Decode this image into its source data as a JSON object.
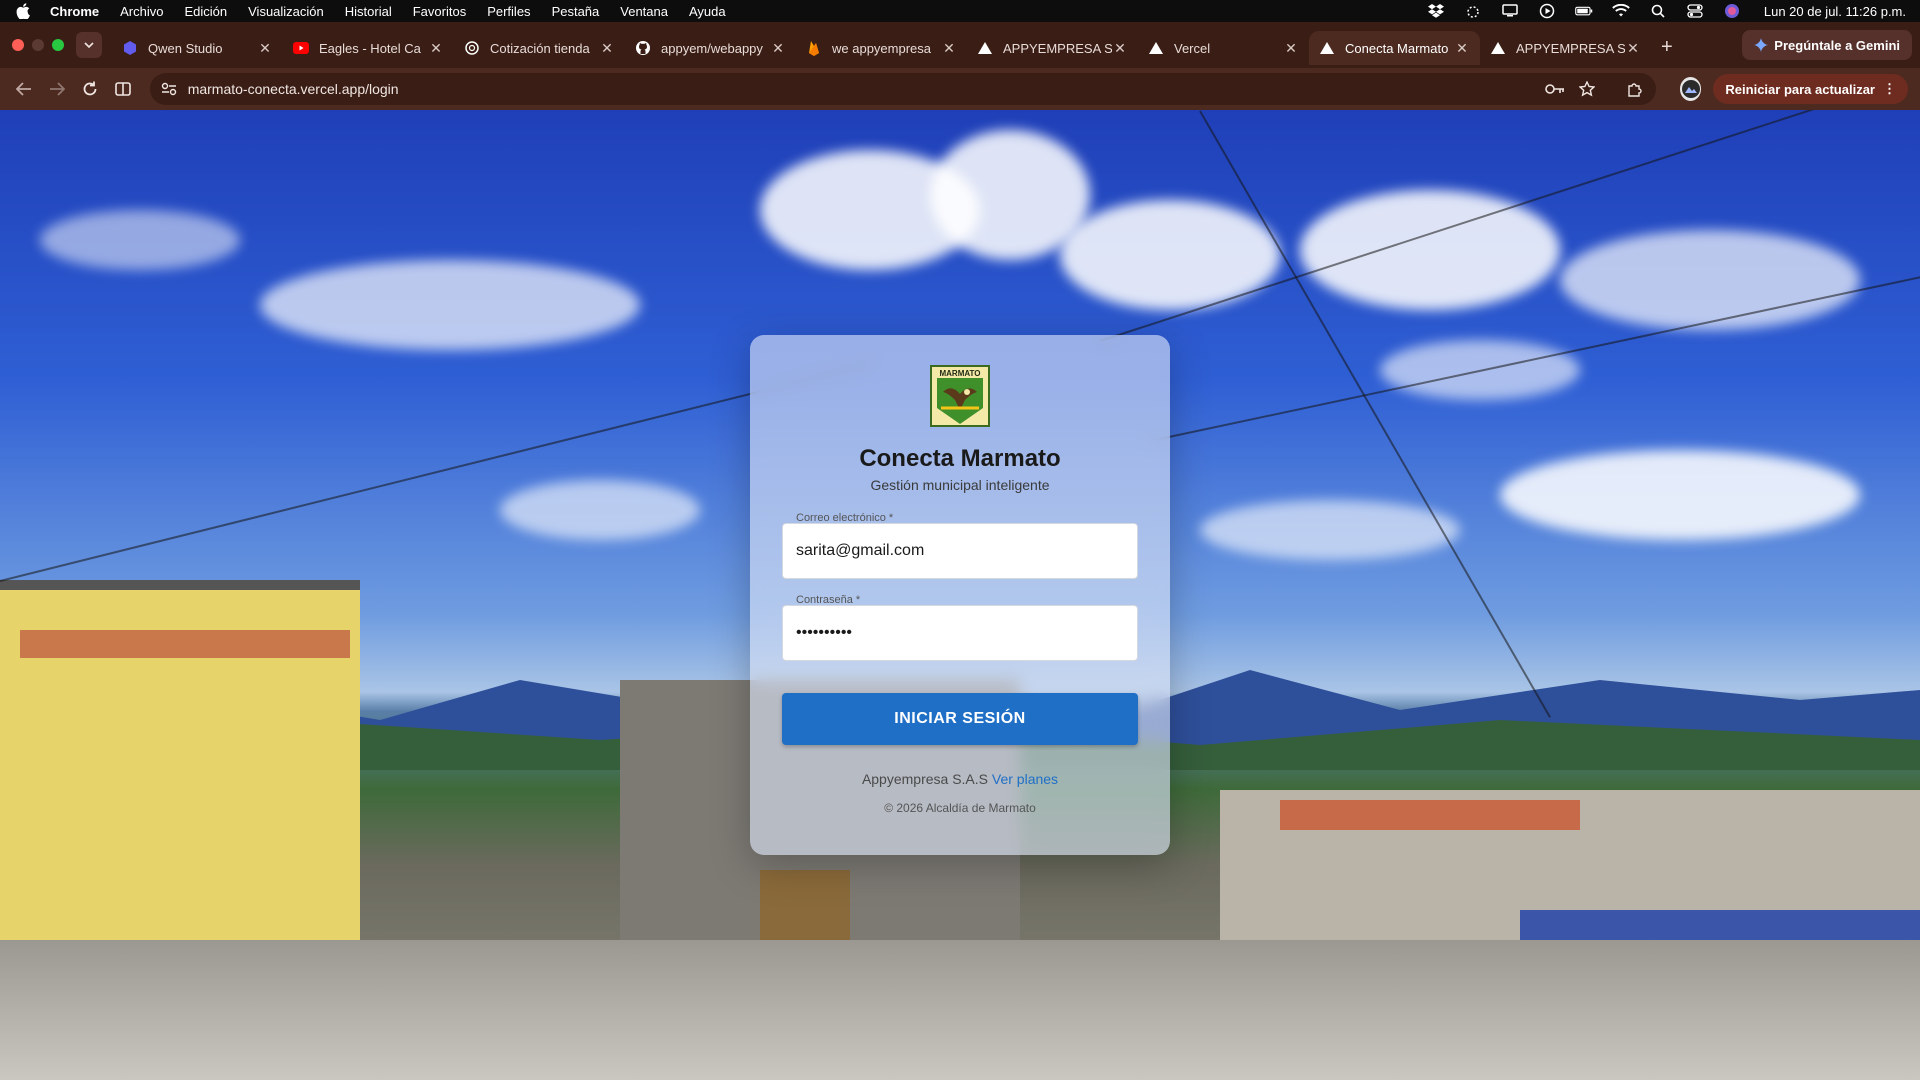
{
  "menubar": {
    "app": "Chrome",
    "items": [
      "Archivo",
      "Edición",
      "Visualización",
      "Historial",
      "Favoritos",
      "Perfiles",
      "Pestaña",
      "Ventana",
      "Ayuda"
    ],
    "clock": "Lun 20 de jul.  11:26 p.m."
  },
  "tabs": [
    {
      "title": "Qwen Studio",
      "icon": "qwen-icon",
      "active": false
    },
    {
      "title": "Eagles - Hotel Ca",
      "icon": "youtube-icon",
      "active": false
    },
    {
      "title": "Cotización tienda",
      "icon": "openai-icon",
      "active": false
    },
    {
      "title": "appyem/webappy",
      "icon": "github-icon",
      "active": false
    },
    {
      "title": "we appyempresa",
      "icon": "firebase-icon",
      "active": false
    },
    {
      "title": "APPYEMPRESA S",
      "icon": "vercel-icon",
      "active": false
    },
    {
      "title": "Vercel",
      "icon": "vercel-icon",
      "active": false
    },
    {
      "title": "Conecta Marmato",
      "icon": "vercel-icon",
      "active": true
    },
    {
      "title": "APPYEMPRESA S",
      "icon": "vercel-icon",
      "active": false
    }
  ],
  "gemini_button": "Pregúntale a Gemini",
  "toolbar": {
    "url": "marmato-conecta.vercel.app/login",
    "restart_button": "Reiniciar para actualizar"
  },
  "login": {
    "logo_text": "MARMATO",
    "title": "Conecta Marmato",
    "subtitle": "Gestión municipal inteligente",
    "email_label": "Correo electrónico *",
    "email_value": "sarita@gmail.com",
    "password_label": "Contraseña *",
    "password_value": "••••••••••",
    "submit": "INICIAR SESIÓN",
    "company": "Appyempresa S.A.S",
    "plans_link": "Ver planes",
    "copyright": "© 2026 Alcaldía de Marmato"
  },
  "colors": {
    "tabstrip": "#3a1d14",
    "toolbar": "#4d2a20",
    "primary_button": "#1f6fc7",
    "sky": "#2f5fd4"
  }
}
